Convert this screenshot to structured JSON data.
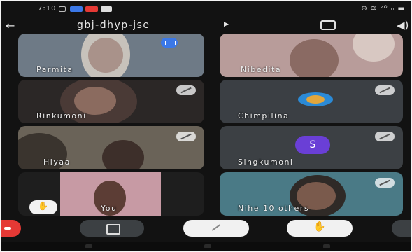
{
  "status_bar": {
    "time": "7:10",
    "right": "⊕ ≋ ᵛᴼ ᵢᵢ ▬"
  },
  "meeting": {
    "code": "gbj-dhyp-jse"
  },
  "participants": [
    {
      "name": "Parmita",
      "state": "speaking"
    },
    {
      "name": "Nibedita",
      "state": "unmuted"
    },
    {
      "name": "Rinkumoni",
      "state": "muted"
    },
    {
      "name": "Chimpilina",
      "state": "muted"
    },
    {
      "name": "Hiyaa",
      "state": "muted"
    },
    {
      "name": "Singkumoni",
      "state": "muted",
      "avatar_letter": "S"
    },
    {
      "name": "You",
      "state": "hand-raised"
    },
    {
      "name": "Nihe 10 others",
      "state": "muted"
    }
  ],
  "colors": {
    "speaking": "#3b78e7",
    "end_call": "#e53935",
    "avatar": "#6a3fd6"
  },
  "icons": [
    "back-arrow-icon",
    "caret-right-icon",
    "camera-switch-icon",
    "speaker-icon",
    "mic-off-icon",
    "hand-raise-icon",
    "end-call-icon",
    "camera-off-icon",
    "more-options-icon"
  ]
}
